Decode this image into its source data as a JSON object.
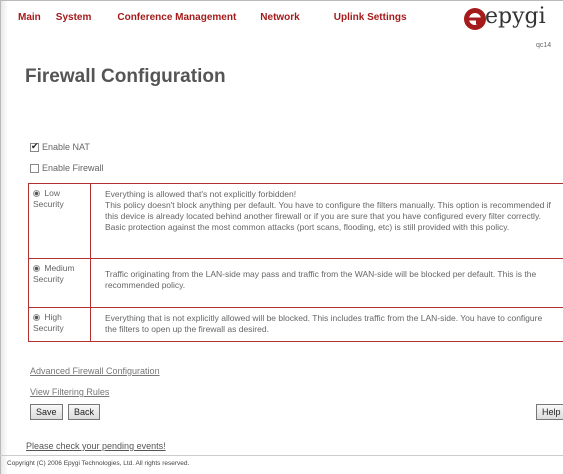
{
  "nav": {
    "items": [
      "Main",
      "System",
      "Conference Management",
      "Network",
      "Uplink Settings"
    ]
  },
  "brand": {
    "name": "epygi",
    "device_id": "qc14"
  },
  "page": {
    "title": "Firewall Configuration"
  },
  "options": {
    "enable_nat": {
      "label": "Enable NAT",
      "checked": true
    },
    "enable_firewall": {
      "label": "Enable Firewall",
      "checked": false
    }
  },
  "security_levels": [
    {
      "label": "Low Security",
      "description": "Everything is allowed that's not explicitly forbidden!\nThis policy doesn't block anything per default. You have to configure the filters manually. This option is recommended if this device is already located behind another firewall or if you are sure that you have configured every filter correctly. Basic protection against the most common attacks (port scans, flooding, etc) is still provided with this policy."
    },
    {
      "label": "Medium Security",
      "description": "Traffic originating from the LAN-side may pass and traffic from the WAN-side will be blocked per default. This is the recommended policy."
    },
    {
      "label": "High Security",
      "description": "Everything that is not explicitly allowed will be blocked. This includes traffic from the LAN-side. You have to configure the filters to open up the firewall as desired."
    }
  ],
  "links": {
    "advanced": "Advanced Firewall Configuration",
    "view_rules": "View Filtering Rules",
    "pending": "Please check your pending events!"
  },
  "buttons": {
    "save": "Save",
    "back": "Back",
    "help": "Help"
  },
  "footer": {
    "copyright": "Copyright (C) 2006 Epygi Technologies, Ltd. All rights reserved."
  },
  "colors": {
    "nav_red": "#a51b1b",
    "table_border": "#b53030"
  }
}
